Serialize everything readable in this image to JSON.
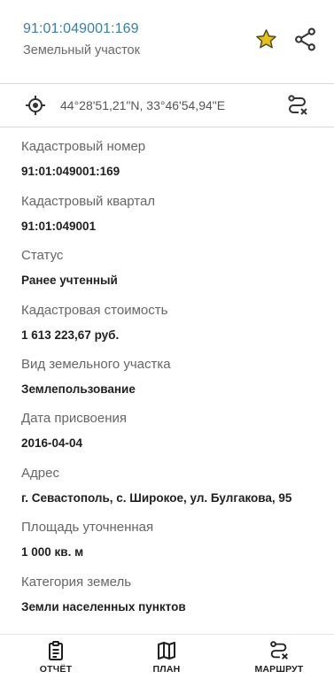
{
  "header": {
    "cadastral_number": "91:01:049001:169",
    "object_type": "Земельный участок"
  },
  "coordinates": {
    "text": "44°28'51,21\"N, 33°46'54,94\"E"
  },
  "details": [
    {
      "label": "Кадастровый номер",
      "value": "91:01:049001:169"
    },
    {
      "label": "Кадастровый квартал",
      "value": "91:01:049001"
    },
    {
      "label": "Статус",
      "value": "Ранее учтенный"
    },
    {
      "label": "Кадастровая стоимость",
      "value": "1 613 223,67 руб."
    },
    {
      "label": "Вид земельного участка",
      "value": "Землепользование"
    },
    {
      "label": "Дата присвоения",
      "value": "2016-04-04"
    },
    {
      "label": "Адрес",
      "value": "г. Севастополь, с. Широкое, ул. Булгакова, 95"
    },
    {
      "label": "Площадь уточненная",
      "value": "1 000 кв. м"
    },
    {
      "label": "Категория земель",
      "value": "Земли населенных пунктов"
    }
  ],
  "bottom_nav": {
    "report": "ОТЧЁТ",
    "plan": "ПЛАН",
    "route": "МАРШРУТ"
  },
  "colors": {
    "accent": "#3d7fa0",
    "star": "#e6c11d"
  },
  "icons": {
    "favorite": "star-icon",
    "share": "share-icon",
    "location": "gps-target-icon",
    "route_clear": "route-clear-icon",
    "report": "clipboard-icon",
    "plan": "map-icon",
    "route": "route-icon"
  }
}
